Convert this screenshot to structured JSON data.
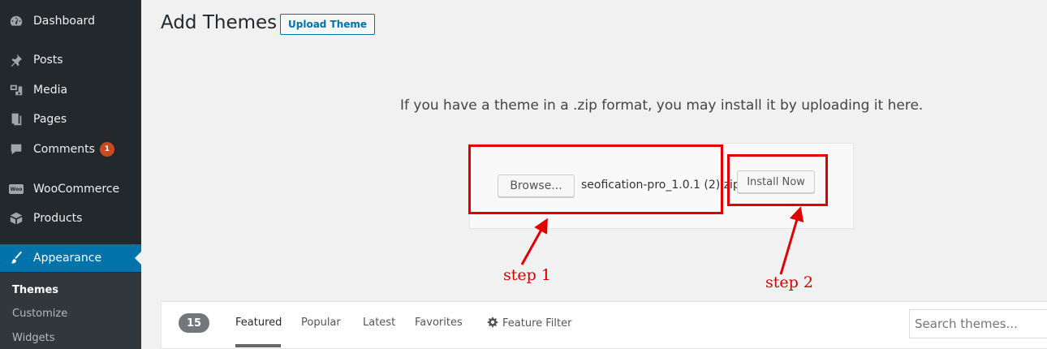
{
  "sidebar": {
    "items": [
      {
        "label": "Dashboard",
        "icon": "dashboard-icon"
      },
      {
        "label": "Posts",
        "icon": "pin-icon"
      },
      {
        "label": "Media",
        "icon": "media-icon"
      },
      {
        "label": "Pages",
        "icon": "pages-icon"
      },
      {
        "label": "Comments",
        "icon": "comment-icon",
        "badge": "1"
      },
      {
        "label": "WooCommerce",
        "icon": "woocommerce-icon",
        "logo_text": "Woo"
      },
      {
        "label": "Products",
        "icon": "products-icon"
      },
      {
        "label": "Appearance",
        "icon": "paintbrush-icon",
        "active": true
      }
    ],
    "submenu": [
      {
        "label": "Themes",
        "current": true
      },
      {
        "label": "Customize"
      },
      {
        "label": "Widgets"
      }
    ],
    "colors": {
      "background": "#23282d",
      "active": "#0073aa",
      "badge": "#ca4a1f"
    }
  },
  "page": {
    "title": "Add Themes",
    "upload_button": "Upload Theme"
  },
  "upload": {
    "description": "If you have a theme in a .zip format, you may install it by uploading it here.",
    "browse_button": "Browse...",
    "file_name": "seofication-pro_1.0.1 (2).zip",
    "install_button": "Install Now"
  },
  "annotations": {
    "step1": "step 1",
    "step2": "step 2",
    "color": "#e00000"
  },
  "filter_bar": {
    "count": "15",
    "tabs": [
      "Featured",
      "Popular",
      "Latest",
      "Favorites"
    ],
    "current_tab": "Featured",
    "feature_filter": "Feature Filter",
    "search_placeholder": "Search themes..."
  }
}
